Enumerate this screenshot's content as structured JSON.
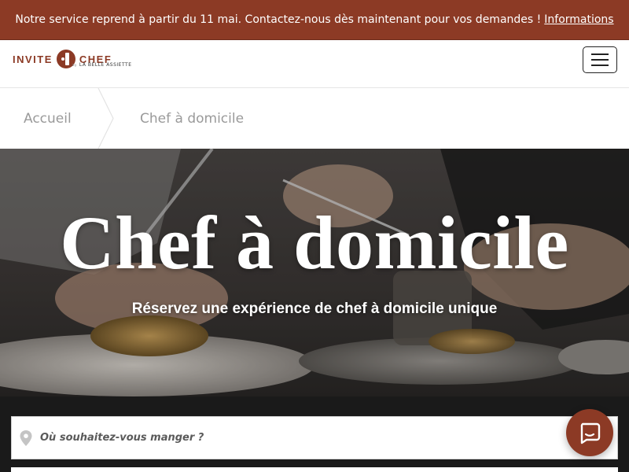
{
  "banner": {
    "message": "Notre service reprend à partir du 11 mai. Contactez-nous dès maintenant pour vos demandes !",
    "link_label": "Informations"
  },
  "header": {
    "logo_left": "INVITE",
    "logo_right": "CHEF",
    "logo_by": "by",
    "logo_sub": "LA BELLE ASSIETTE",
    "menu_icon": "hamburger-icon"
  },
  "breadcrumb": {
    "items": [
      "Accueil",
      "Chef à domicile"
    ]
  },
  "hero": {
    "title": "Chef à domicile",
    "subtitle": "Réservez une expérience de chef à domicile unique"
  },
  "search": {
    "placeholder": "Où souhaitez-vous manger ?",
    "icon": "map-pin-icon"
  },
  "chat": {
    "icon": "chat-bubble-icon"
  },
  "colors": {
    "brand": "#8c3a25",
    "dark_band": "#1a1a1a",
    "breadcrumb_text": "#9a9a9a"
  }
}
